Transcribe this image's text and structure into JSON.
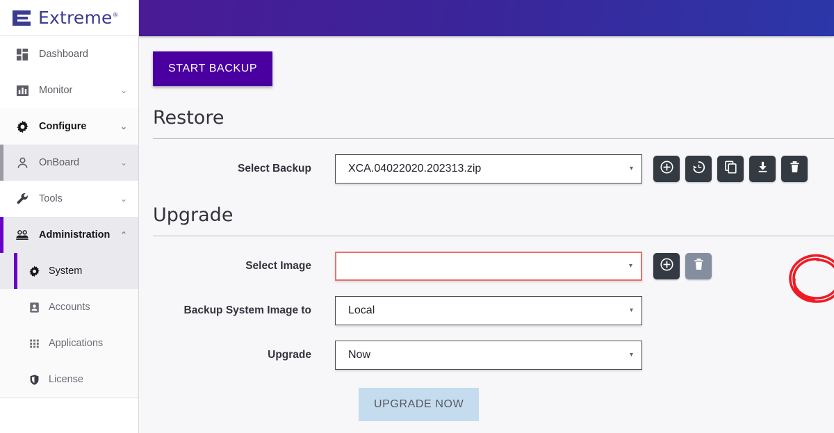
{
  "brand": {
    "name": "Extreme",
    "registered_mark": "®",
    "logo_icon": "extreme-e-logo"
  },
  "sidebar": {
    "items": [
      {
        "label": "Dashboard",
        "icon": "dashboard-grid-icon",
        "chevron": "",
        "state": "plain"
      },
      {
        "label": "Monitor",
        "icon": "bar-chart-icon",
        "chevron": "⌄",
        "state": "plain"
      },
      {
        "label": "Configure",
        "icon": "gear-icon",
        "chevron": "⌄",
        "state": "active-bold"
      },
      {
        "label": "OnBoard",
        "icon": "person-icon",
        "chevron": "⌄",
        "state": "hovered"
      },
      {
        "label": "Tools",
        "icon": "wrench-icon",
        "chevron": "⌄",
        "state": "plain"
      },
      {
        "label": "Administration",
        "icon": "people-group-icon",
        "chevron": "⌃",
        "state": "sel"
      }
    ],
    "submenu": [
      {
        "label": "System",
        "icon": "gear-icon",
        "selected": true
      },
      {
        "label": "Accounts",
        "icon": "id-card-icon",
        "selected": false
      },
      {
        "label": "Applications",
        "icon": "grid-dots-icon",
        "selected": false
      },
      {
        "label": "License",
        "icon": "shield-icon",
        "selected": false
      }
    ]
  },
  "main": {
    "start_backup_label": "START BACKUP",
    "restore": {
      "title": "Restore",
      "select_backup_label": "Select Backup",
      "select_backup_value": "XCA.04022020.202313.zip",
      "caret": "▾",
      "actions": [
        {
          "icon": "add-circle-icon",
          "name": "add-backup-button",
          "disabled": false
        },
        {
          "icon": "restore-clock-icon",
          "name": "restore-backup-button",
          "disabled": false
        },
        {
          "icon": "copy-icon",
          "name": "duplicate-backup-button",
          "disabled": false
        },
        {
          "icon": "download-icon",
          "name": "download-backup-button",
          "disabled": false
        },
        {
          "icon": "trash-icon",
          "name": "delete-backup-button",
          "disabled": false
        }
      ]
    },
    "upgrade": {
      "title": "Upgrade",
      "select_image_label": "Select Image",
      "select_image_value": "",
      "select_image_error": true,
      "image_actions": [
        {
          "icon": "add-circle-icon",
          "name": "add-image-button",
          "disabled": false
        },
        {
          "icon": "trash-icon",
          "name": "delete-image-button",
          "disabled": true
        }
      ],
      "backup_to_label": "Backup System Image to",
      "backup_to_value": "Local",
      "upgrade_when_label": "Upgrade",
      "upgrade_when_value": "Now",
      "upgrade_now_label": "UPGRADE NOW"
    }
  },
  "annotation": {
    "type": "hand-drawn-circle",
    "color": "#ee1c25",
    "target": "add-image-button"
  },
  "colors": {
    "brand_purple": "#4a00a0",
    "header_gradient_start": "#4a1b96",
    "header_gradient_end": "#2c37a8",
    "accent_bar": "#6a00c8",
    "icon_button_bg": "#343a42",
    "error_border": "#e8716b",
    "disabled_button_bg": "#c5dcee",
    "annotation_red": "#ee1c25"
  }
}
